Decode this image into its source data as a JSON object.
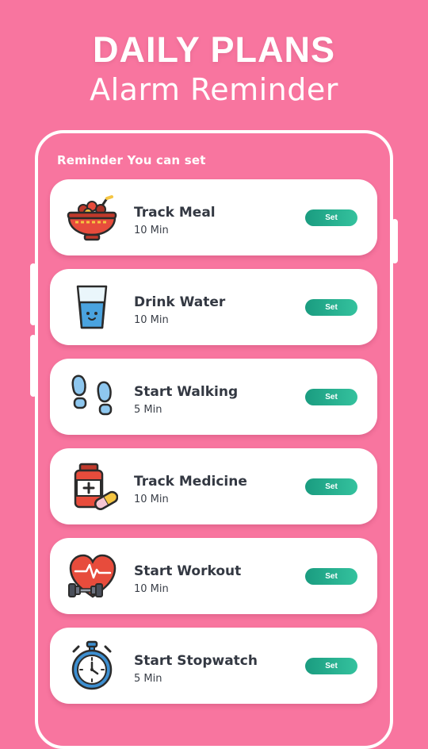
{
  "header": {
    "title": "DAILY PLANS",
    "subtitle": "Alarm Reminder"
  },
  "section": {
    "label": "Reminder You can set"
  },
  "reminders": [
    {
      "name": "Track Meal",
      "duration": "10 Min",
      "button": "Set",
      "icon": "meal-bowl-icon"
    },
    {
      "name": "Drink Water",
      "duration": "10 Min",
      "button": "Set",
      "icon": "water-glass-icon"
    },
    {
      "name": "Start Walking",
      "duration": "5 Min",
      "button": "Set",
      "icon": "footprints-icon"
    },
    {
      "name": "Track Medicine",
      "duration": "10 Min",
      "button": "Set",
      "icon": "medicine-icon"
    },
    {
      "name": "Start Workout",
      "duration": "10 Min",
      "button": "Set",
      "icon": "heart-dumbbell-icon"
    },
    {
      "name": "Start Stopwatch",
      "duration": "5 Min",
      "button": "Set",
      "icon": "stopwatch-icon"
    }
  ],
  "colors": {
    "background": "#f8759f",
    "button": "#1a9c80",
    "card": "#ffffff"
  }
}
